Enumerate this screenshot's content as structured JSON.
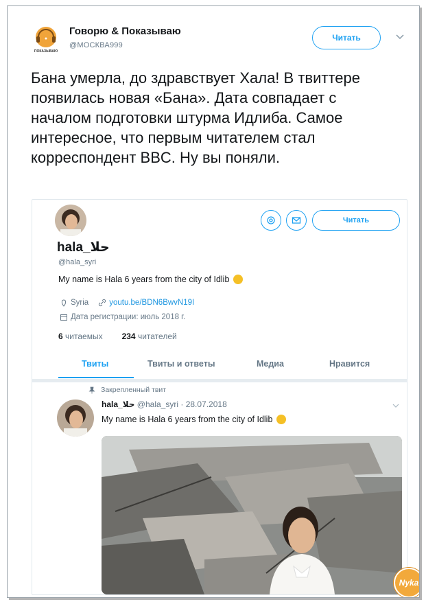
{
  "outer_tweet": {
    "author_name": "Говорю & Показываю",
    "author_handle": "@МОСКВА999",
    "logo_caption": "ПОКАЗЫВАЮ",
    "follow_label": "Читать",
    "text": "Бана умерла, до здравствует Хала! В твиттере появилась новая «Бана». Дата совпадает с началом подготовки штурма Идлиба. Самое интересное, что первым читателем стал корреспондент BBC. Ну вы поняли."
  },
  "profile": {
    "name": "hala_حلا",
    "handle": "@hala_syri",
    "bio": "My name is Hala 6 years from the city of Idlib",
    "location": "Syria",
    "link": "youtu.be/BDN6BwvN19I",
    "joined": "Дата регистрации: июль 2018 г.",
    "following_count": "6",
    "following_label": "читаемых",
    "followers_count": "234",
    "followers_label": "читателей",
    "follow_label": "Читать"
  },
  "tabs": [
    {
      "label": "Твиты",
      "active": true
    },
    {
      "label": "Твиты и ответы",
      "active": false
    },
    {
      "label": "Медиа",
      "active": false
    },
    {
      "label": "Нравится",
      "active": false
    }
  ],
  "pinned_tweet": {
    "pinned_label": "Закрепленный твит",
    "name": "hala_حلا",
    "handle": "@hala_syri",
    "date": "· 28.07.2018",
    "text": "My name is Hala 6 years from the city of Idlib"
  },
  "watermark": "Nyka",
  "colors": {
    "accent": "#1da1f2",
    "text": "#14171a",
    "muted": "#657786",
    "logo": "#f2a93b"
  },
  "icons": [
    "radio-logo-icon",
    "chevron-down-icon",
    "gear-icon",
    "mail-icon",
    "location-pin-icon",
    "link-icon",
    "calendar-icon",
    "pin-icon",
    "smile-emoji-icon"
  ]
}
